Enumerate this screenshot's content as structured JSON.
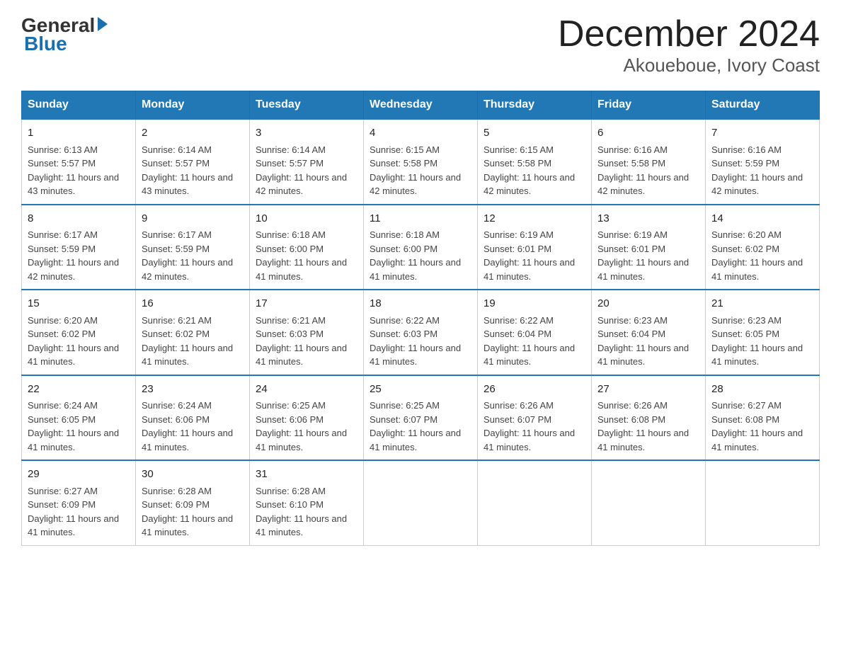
{
  "logo": {
    "general": "General",
    "blue": "Blue"
  },
  "title": "December 2024",
  "subtitle": "Akoueboue, Ivory Coast",
  "days_header": [
    "Sunday",
    "Monday",
    "Tuesday",
    "Wednesday",
    "Thursday",
    "Friday",
    "Saturday"
  ],
  "weeks": [
    [
      {
        "day": "1",
        "sunrise": "6:13 AM",
        "sunset": "5:57 PM",
        "daylight": "11 hours and 43 minutes."
      },
      {
        "day": "2",
        "sunrise": "6:14 AM",
        "sunset": "5:57 PM",
        "daylight": "11 hours and 43 minutes."
      },
      {
        "day": "3",
        "sunrise": "6:14 AM",
        "sunset": "5:57 PM",
        "daylight": "11 hours and 42 minutes."
      },
      {
        "day": "4",
        "sunrise": "6:15 AM",
        "sunset": "5:58 PM",
        "daylight": "11 hours and 42 minutes."
      },
      {
        "day": "5",
        "sunrise": "6:15 AM",
        "sunset": "5:58 PM",
        "daylight": "11 hours and 42 minutes."
      },
      {
        "day": "6",
        "sunrise": "6:16 AM",
        "sunset": "5:58 PM",
        "daylight": "11 hours and 42 minutes."
      },
      {
        "day": "7",
        "sunrise": "6:16 AM",
        "sunset": "5:59 PM",
        "daylight": "11 hours and 42 minutes."
      }
    ],
    [
      {
        "day": "8",
        "sunrise": "6:17 AM",
        "sunset": "5:59 PM",
        "daylight": "11 hours and 42 minutes."
      },
      {
        "day": "9",
        "sunrise": "6:17 AM",
        "sunset": "5:59 PM",
        "daylight": "11 hours and 42 minutes."
      },
      {
        "day": "10",
        "sunrise": "6:18 AM",
        "sunset": "6:00 PM",
        "daylight": "11 hours and 41 minutes."
      },
      {
        "day": "11",
        "sunrise": "6:18 AM",
        "sunset": "6:00 PM",
        "daylight": "11 hours and 41 minutes."
      },
      {
        "day": "12",
        "sunrise": "6:19 AM",
        "sunset": "6:01 PM",
        "daylight": "11 hours and 41 minutes."
      },
      {
        "day": "13",
        "sunrise": "6:19 AM",
        "sunset": "6:01 PM",
        "daylight": "11 hours and 41 minutes."
      },
      {
        "day": "14",
        "sunrise": "6:20 AM",
        "sunset": "6:02 PM",
        "daylight": "11 hours and 41 minutes."
      }
    ],
    [
      {
        "day": "15",
        "sunrise": "6:20 AM",
        "sunset": "6:02 PM",
        "daylight": "11 hours and 41 minutes."
      },
      {
        "day": "16",
        "sunrise": "6:21 AM",
        "sunset": "6:02 PM",
        "daylight": "11 hours and 41 minutes."
      },
      {
        "day": "17",
        "sunrise": "6:21 AM",
        "sunset": "6:03 PM",
        "daylight": "11 hours and 41 minutes."
      },
      {
        "day": "18",
        "sunrise": "6:22 AM",
        "sunset": "6:03 PM",
        "daylight": "11 hours and 41 minutes."
      },
      {
        "day": "19",
        "sunrise": "6:22 AM",
        "sunset": "6:04 PM",
        "daylight": "11 hours and 41 minutes."
      },
      {
        "day": "20",
        "sunrise": "6:23 AM",
        "sunset": "6:04 PM",
        "daylight": "11 hours and 41 minutes."
      },
      {
        "day": "21",
        "sunrise": "6:23 AM",
        "sunset": "6:05 PM",
        "daylight": "11 hours and 41 minutes."
      }
    ],
    [
      {
        "day": "22",
        "sunrise": "6:24 AM",
        "sunset": "6:05 PM",
        "daylight": "11 hours and 41 minutes."
      },
      {
        "day": "23",
        "sunrise": "6:24 AM",
        "sunset": "6:06 PM",
        "daylight": "11 hours and 41 minutes."
      },
      {
        "day": "24",
        "sunrise": "6:25 AM",
        "sunset": "6:06 PM",
        "daylight": "11 hours and 41 minutes."
      },
      {
        "day": "25",
        "sunrise": "6:25 AM",
        "sunset": "6:07 PM",
        "daylight": "11 hours and 41 minutes."
      },
      {
        "day": "26",
        "sunrise": "6:26 AM",
        "sunset": "6:07 PM",
        "daylight": "11 hours and 41 minutes."
      },
      {
        "day": "27",
        "sunrise": "6:26 AM",
        "sunset": "6:08 PM",
        "daylight": "11 hours and 41 minutes."
      },
      {
        "day": "28",
        "sunrise": "6:27 AM",
        "sunset": "6:08 PM",
        "daylight": "11 hours and 41 minutes."
      }
    ],
    [
      {
        "day": "29",
        "sunrise": "6:27 AM",
        "sunset": "6:09 PM",
        "daylight": "11 hours and 41 minutes."
      },
      {
        "day": "30",
        "sunrise": "6:28 AM",
        "sunset": "6:09 PM",
        "daylight": "11 hours and 41 minutes."
      },
      {
        "day": "31",
        "sunrise": "6:28 AM",
        "sunset": "6:10 PM",
        "daylight": "11 hours and 41 minutes."
      },
      null,
      null,
      null,
      null
    ]
  ],
  "labels": {
    "sunrise_prefix": "Sunrise: ",
    "sunset_prefix": "Sunset: ",
    "daylight_prefix": "Daylight: "
  }
}
